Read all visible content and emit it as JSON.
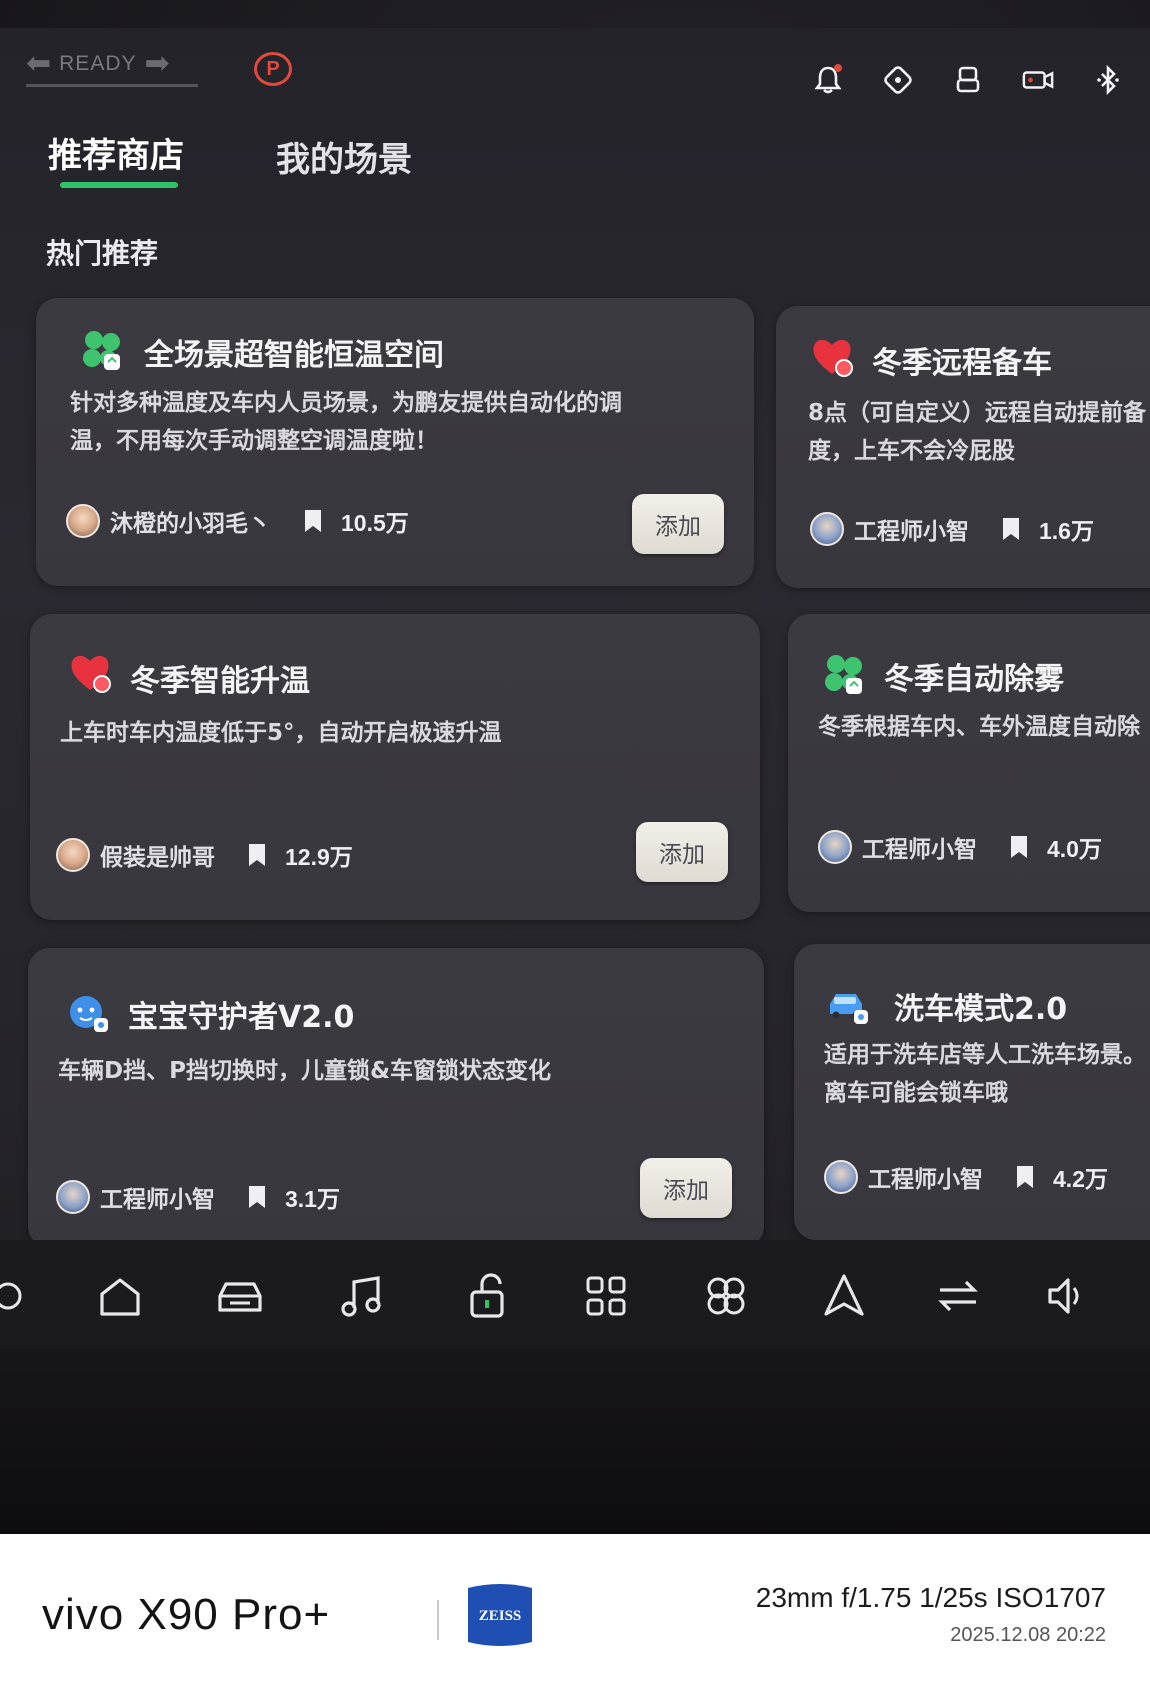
{
  "status_bar": {
    "gear_indicator": "READY",
    "parking_indicator": "P",
    "icons": [
      "bell-icon",
      "steering-wheel-icon",
      "seat-icon",
      "dashcam-icon",
      "bluetooth-icon"
    ]
  },
  "tabs": [
    {
      "label": "推荐商店",
      "active": true
    },
    {
      "label": "我的场景",
      "active": false
    }
  ],
  "section_title": "热门推荐",
  "cards": [
    {
      "icon": "fan-icon",
      "title": "全场景超智能恒温空间",
      "desc_line1": "针对多种温度及车内人员场景，为鹏友提供自动化的调",
      "desc_line2": "温，不用每次手动调整空调温度啦！",
      "author": "沐橙的小羽毛丶",
      "count": "10.5万",
      "button": "添加"
    },
    {
      "icon": "heart-icon",
      "title": "冬季远程备车",
      "desc_line1": "8点（可自定义）远程自动提前备",
      "desc_line2": "度，上车不会冷屁股",
      "author": "工程师小智",
      "count": "1.6万"
    },
    {
      "icon": "heart-icon",
      "title": "冬季智能升温",
      "desc_line1": "上车时车内温度低于5°，自动开启极速升温",
      "author": "假装是帅哥",
      "count": "12.9万",
      "button": "添加"
    },
    {
      "icon": "fan-icon",
      "title": "冬季自动除雾",
      "desc_line1": "冬季根据车内、车外温度自动除",
      "author": "工程师小智",
      "count": "4.0万"
    },
    {
      "icon": "baby-guard-icon",
      "title": "宝宝守护者V2.0",
      "desc_line1": "车辆D挡、P挡切换时，儿童锁&车窗锁状态变化",
      "author": "工程师小智",
      "count": "3.1万",
      "button": "添加"
    },
    {
      "icon": "car-wash-icon",
      "title": "洗车模式2.0",
      "desc_line1": "适用于洗车店等人工洗车场景。",
      "desc_line2": "离车可能会锁车哦",
      "author": "工程师小智",
      "count": "4.2万"
    }
  ],
  "dock_icons": [
    "voice-icon",
    "home-icon",
    "car-icon",
    "music-icon",
    "unlock-icon",
    "apps-icon",
    "fan-control-icon",
    "navigation-icon",
    "switch-icon",
    "volume-icon"
  ],
  "watermark": {
    "brand": "vivo X90 Pro+",
    "lens_logo": "ZEISS",
    "exif": "23mm  f/1.75  1/25s  ISO1707",
    "date": "2025.12.08 20:22"
  },
  "colors": {
    "accent_green": "#2fc46a",
    "park_red": "#e14a3c",
    "card_bg": "#3b3a40"
  }
}
